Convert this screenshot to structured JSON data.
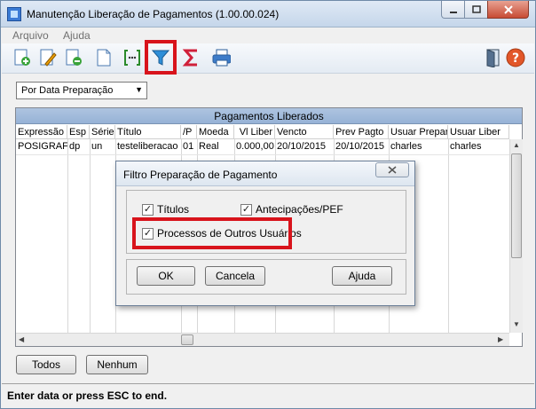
{
  "window": {
    "title": "Manutenção Liberação de Pagamentos (1.00.00.024)"
  },
  "menu": {
    "items": [
      "Arquivo",
      "Ajuda"
    ]
  },
  "toolbar": {
    "buttons": [
      "add-icon",
      "edit-icon",
      "remove-icon",
      "document-icon",
      "bracket-icon",
      "filter-icon",
      "sum-icon",
      "print-icon"
    ],
    "right_buttons": [
      "exit-door-icon",
      "help-icon"
    ],
    "highlighted": "filter-icon"
  },
  "filter_combo": {
    "value": "Por Data Preparação"
  },
  "grid": {
    "title": "Pagamentos Liberados",
    "columns": [
      "Expressão",
      "Esp",
      "Série",
      "Título",
      "/P",
      "Moeda",
      "Vl Liber",
      "Vencto",
      "Prev Pagto",
      "Usuar Prepar",
      "Usuar Liber"
    ],
    "rows": [
      [
        "POSIGRAF",
        "dp",
        "un",
        "testeliberacao",
        "01",
        "Real",
        "0.000,00",
        "20/10/2015",
        "20/10/2015",
        "charles",
        "charles"
      ]
    ]
  },
  "buttons": {
    "todos": "Todos",
    "nenhum": "Nenhum"
  },
  "status": {
    "text": "Enter data or press ESC to end."
  },
  "dialog": {
    "title": "Filtro Preparação de Pagamento",
    "checkboxes": {
      "titulos": {
        "label": "Títulos",
        "checked": true
      },
      "antecipacoes": {
        "label": "Antecipações/PEF",
        "checked": true
      },
      "outros_usuarios": {
        "label": "Processos de Outros Usuários",
        "checked": true
      }
    },
    "ok": "OK",
    "cancela": "Cancela",
    "ajuda": "Ajuda"
  },
  "colors": {
    "highlight": "#d8141c",
    "grid_header": "#aec4e0"
  }
}
